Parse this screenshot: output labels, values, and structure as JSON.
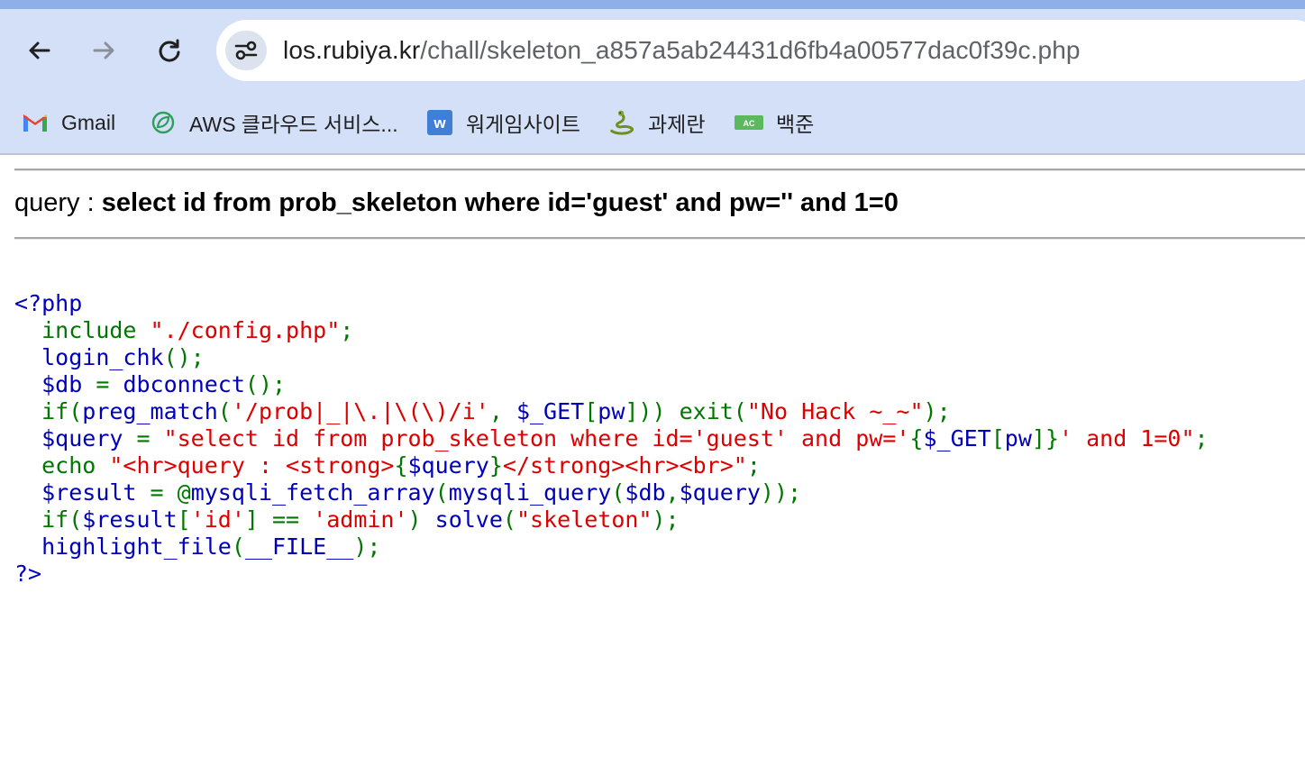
{
  "browser": {
    "url_host": "los.rubiya.kr",
    "url_path": "/chall/skeleton_a857a5ab24431d6fb4a00577dac0f39c.php",
    "back_icon": "arrow-left-icon",
    "forward_icon": "arrow-right-icon",
    "reload_icon": "reload-icon",
    "site_info_icon": "tune-icon",
    "colors": {
      "toolbar_bg": "#d3e0f7",
      "top_strip": "#8fb0e6",
      "omnibox_bg": "#ffffff"
    }
  },
  "bookmarks": [
    {
      "label": "Gmail",
      "icon": "gmail-icon"
    },
    {
      "label": "AWS 클라우드 서비스...",
      "icon": "aws-leaf-icon"
    },
    {
      "label": "워게임사이트",
      "icon": "w-icon"
    },
    {
      "label": "과제란",
      "icon": "snake-icon"
    },
    {
      "label": "백준",
      "icon": "ac-icon"
    }
  ],
  "page": {
    "query_prefix": "query : ",
    "query_sql": "select id from prob_skeleton where id='guest' and pw='' and 1=0",
    "code": {
      "l1": "<?php",
      "l2_kw": "include ",
      "l2_str": "\"./config.php\"",
      "l2_end": ";",
      "l3_fn": "login_chk",
      "l3_end": "();",
      "l4_var": "$db ",
      "l4_eq": "= ",
      "l4_fn": "dbconnect",
      "l4_end": "();",
      "l5_if": "if(",
      "l5_fn": "preg_match",
      "l5_p": "(",
      "l5_regex": "'/prob|_|\\.|\\(\\)/i'",
      "l5_comma": ", ",
      "l5_get": "$_GET",
      "l5_b1": "[",
      "l5_pw": "pw",
      "l5_b2": "])) ",
      "l5_exit": "exit(",
      "l5_msg": "\"No Hack ~_~\"",
      "l5_end": ");",
      "l6_var": "$query ",
      "l6_eq": "= ",
      "l6_s1": "\"select id from prob_skeleton where id='guest' and pw='",
      "l6_br1": "{",
      "l6_get": "$_GET",
      "l6_b1": "[",
      "l6_pw": "pw",
      "l6_b2": "]}",
      "l6_s2": "' and 1=0\"",
      "l6_end": ";",
      "l7_echo": "echo ",
      "l7_s1": "\"<hr>query : <strong>",
      "l7_br1": "{",
      "l7_var": "$query",
      "l7_br2": "}",
      "l7_s2": "</strong><hr><br>\"",
      "l7_end": ";",
      "l8_var": "$result ",
      "l8_eq": "= ",
      "l8_at": "@",
      "l8_fn1": "mysqli_fetch_array",
      "l8_p1": "(",
      "l8_fn2": "mysqli_query",
      "l8_p2": "(",
      "l8_args": "$db",
      "l8_comma": ",",
      "l8_q": "$query",
      "l8_end": "));",
      "l9_if": "if(",
      "l9_var": "$result",
      "l9_b": "[",
      "l9_id": "'id'",
      "l9_eq": "] == ",
      "l9_admin": "'admin'",
      "l9_close": ") ",
      "l9_fn": "solve",
      "l9_p": "(",
      "l9_s": "\"skeleton\"",
      "l9_end": ");",
      "l10_fn": "highlight_file",
      "l10_p": "(",
      "l10_const": "__FILE__",
      "l10_end": ");",
      "l11": "?>"
    },
    "colors": {
      "php_default": "#0000bb",
      "php_keyword": "#007700",
      "php_string": "#dd0000"
    }
  }
}
